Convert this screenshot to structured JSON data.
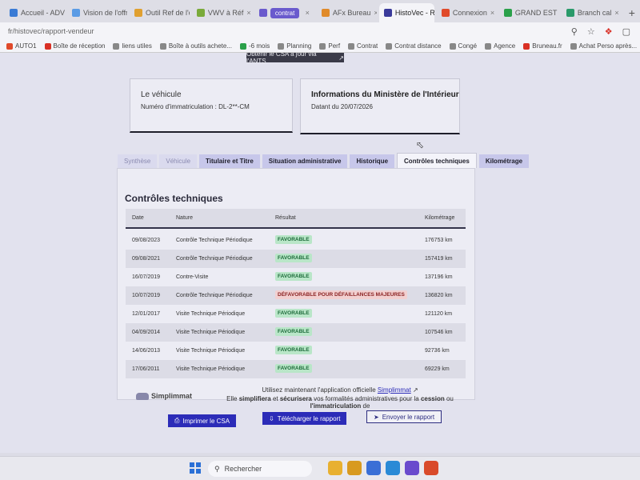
{
  "browser": {
    "tabs": [
      {
        "label": "Accueil - ADV",
        "color": "#3a7bd5"
      },
      {
        "label": "Vision de l'offre",
        "color": "#5a9be5"
      },
      {
        "label": "Outil Ref de l'offre",
        "color": "#e0a030"
      },
      {
        "label": "VWV à Réf",
        "color": "#7aaa3a"
      },
      {
        "label": "contrat",
        "color": "#6a5acd",
        "pill": true
      },
      {
        "label": "AFx Bureau",
        "color": "#e08a2a"
      },
      {
        "label": "HistoVec - R",
        "color": "#3a3a9a",
        "active": true
      },
      {
        "label": "Connexion",
        "color": "#e04a2a"
      },
      {
        "label": "GRAND EST",
        "color": "#2aa04a"
      },
      {
        "label": "Branch cal",
        "color": "#2a9a6a"
      }
    ],
    "url": "fr/histovec/rapport-vendeur",
    "bookmarks": [
      {
        "label": "AUTO1",
        "color": "#e04a2a"
      },
      {
        "label": "Boîte de réception",
        "color": "#d93025"
      },
      {
        "label": "liens utiles",
        "color": "#888"
      },
      {
        "label": "Boîte à outils achete...",
        "color": "#888"
      },
      {
        "label": "-6 mois",
        "color": "#2aa04a"
      },
      {
        "label": "Planning",
        "color": "#888"
      },
      {
        "label": "Perf",
        "color": "#888"
      },
      {
        "label": "Contrat",
        "color": "#888"
      },
      {
        "label": "Contrat distance",
        "color": "#888"
      },
      {
        "label": "Congé",
        "color": "#888"
      },
      {
        "label": "Agence",
        "color": "#888"
      },
      {
        "label": "Bruneau.fr",
        "color": "#d93025"
      },
      {
        "label": "Achat Perso après...",
        "color": "#888"
      }
    ]
  },
  "page": {
    "top_button": "Obtenir le CSA à jour via l'ANTS",
    "vehicle_card": {
      "title": "Le véhicule",
      "line": "Numéro d'immatriculation : DL-2**-CM"
    },
    "ministry_card": {
      "title": "Informations du Ministère de l'Intérieur",
      "line": "Datant du 20/07/2026"
    },
    "tabs": [
      {
        "label": "Synthèse",
        "state": "faint"
      },
      {
        "label": "Véhicule",
        "state": "faint"
      },
      {
        "label": "Titulaire et Titre",
        "state": "normal"
      },
      {
        "label": "Situation administrative",
        "state": "normal"
      },
      {
        "label": "Historique",
        "state": "normal"
      },
      {
        "label": "Contrôles techniques",
        "state": "active"
      },
      {
        "label": "Kilométrage",
        "state": "normal"
      }
    ],
    "section_title": "Contrôles techniques",
    "table": {
      "headers": {
        "date": "Date",
        "nature": "Nature",
        "result": "Résultat",
        "km": "Kilométrage"
      },
      "rows": [
        {
          "date": "09/08/2023",
          "nature": "Contrôle Technique Périodique",
          "result": "FAVORABLE",
          "ok": true,
          "km": "176753 km"
        },
        {
          "date": "09/08/2021",
          "nature": "Contrôle Technique Périodique",
          "result": "FAVORABLE",
          "ok": true,
          "km": "157419 km"
        },
        {
          "date": "16/07/2019",
          "nature": "Contre-Visite",
          "result": "FAVORABLE",
          "ok": true,
          "km": "137196 km"
        },
        {
          "date": "10/07/2019",
          "nature": "Contrôle Technique Périodique",
          "result": "DÉFAVORABLE POUR DÉFAILLANCES MAJEURES",
          "ok": false,
          "km": "136820 km"
        },
        {
          "date": "12/01/2017",
          "nature": "Visite Technique Périodique",
          "result": "FAVORABLE",
          "ok": true,
          "km": "121120 km"
        },
        {
          "date": "04/09/2014",
          "nature": "Visite Technique Périodique",
          "result": "FAVORABLE",
          "ok": true,
          "km": "107546 km"
        },
        {
          "date": "14/06/2013",
          "nature": "Visite Technique Périodique",
          "result": "FAVORABLE",
          "ok": true,
          "km": "92736 km"
        },
        {
          "date": "17/06/2011",
          "nature": "Visite Technique Périodique",
          "result": "FAVORABLE",
          "ok": true,
          "km": "69229 km"
        }
      ]
    },
    "buttons": {
      "print_csa": "Imprimer le CSA",
      "download": "Télécharger le rapport",
      "send": "Envoyer le rapport"
    },
    "promo": {
      "line1_prefix": "Utilisez maintenant l'application officielle ",
      "line1_link": "Simplimmat",
      "line2_a": "Elle ",
      "line2_b": "simplifiera",
      "line2_c": " et ",
      "line2_d": "sécurisera",
      "line2_e": " vos formalités administratives pour la ",
      "line2_f": "cession",
      "line2_g": " ou ",
      "line2_h": "l'immatriculation",
      "line2_i": " de",
      "logo": "Simplimmat"
    }
  },
  "taskbar": {
    "search_placeholder": "Rechercher",
    "apps": [
      {
        "name": "file-explorer",
        "color": "#e8b030"
      },
      {
        "name": "folder",
        "color": "#d89a20"
      },
      {
        "name": "store",
        "color": "#3a6fd6"
      },
      {
        "name": "edge",
        "color": "#2a8ad6"
      },
      {
        "name": "browser-alt",
        "color": "#6a4acd"
      },
      {
        "name": "chrome",
        "color": "#d94a2a"
      }
    ]
  }
}
